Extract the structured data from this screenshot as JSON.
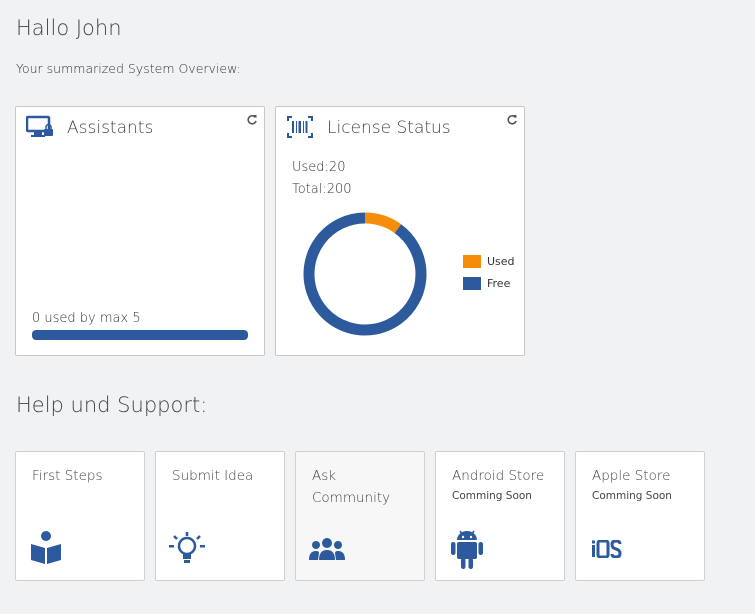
{
  "header": {
    "greeting": "Hallo John",
    "subtitle": "Your summarized System Overview:"
  },
  "assistants_card": {
    "title": "Assistants",
    "icon": "monitor-lock-icon",
    "usage_text": "0 used by max 5",
    "used": 0,
    "max": 5
  },
  "license_card": {
    "title": "License Status",
    "icon": "barcode-icon",
    "used_line": "Used:20",
    "total_line": "Total:200",
    "legend": [
      {
        "label": "Used",
        "color": "#f58c0a"
      },
      {
        "label": "Free",
        "color": "#2d5a9c"
      }
    ]
  },
  "chart_data": {
    "type": "pie",
    "categories": [
      "Used",
      "Free"
    ],
    "values": [
      20,
      180
    ],
    "colors": [
      "#f58c0a",
      "#2d5a9c"
    ],
    "donut": true,
    "legend_position": "right"
  },
  "support": {
    "title": "Help und Support:",
    "tiles": [
      {
        "label": "First Steps",
        "sub": "",
        "icon": "book-reader-icon"
      },
      {
        "label": "Submit Idea",
        "sub": "",
        "icon": "lightbulb-icon"
      },
      {
        "label": "Ask Community",
        "sub": "",
        "icon": "users-icon"
      },
      {
        "label": "Android Store",
        "sub": "Comming Soon",
        "icon": "android-icon"
      },
      {
        "label": "Apple Store",
        "sub": "Comming Soon",
        "icon": "ios-icon"
      }
    ]
  },
  "colors": {
    "primary": "#2d5a9c",
    "accent": "#f58c0a",
    "background": "#f1f2f4"
  }
}
